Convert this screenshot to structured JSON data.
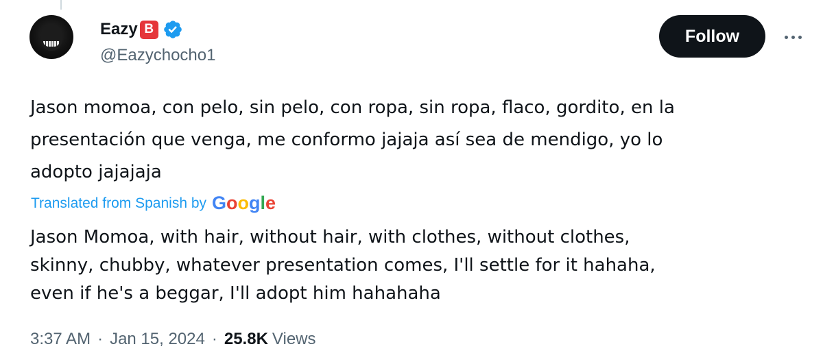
{
  "author": {
    "display_name": "Eazy",
    "badge_letter": "B",
    "handle": "@Eazychocho1"
  },
  "follow_label": "Follow",
  "tweet": {
    "text_lines": [
      "Jason momoa, con pelo, sin pelo, con ropa, sin ropa, flaco, gordito, en la",
      "presentación que venga, me conformo jajaja así sea de mendigo, yo lo",
      "adopto jajajaja"
    ],
    "translated_label": "Translated from Spanish by",
    "translation_provider": [
      "G",
      "o",
      "o",
      "g",
      "l",
      "e"
    ],
    "translation_lines": [
      "Jason Momoa, with hair, without hair, with clothes, without clothes,",
      "skinny, chubby, whatever presentation comes, I'll settle for it hahaha,",
      "even if he's a beggar, I'll adopt him hahahaha"
    ]
  },
  "meta": {
    "time": "3:37 AM",
    "separator": "·",
    "date": "Jan 15, 2024",
    "views_count": "25.8K",
    "views_label": "Views"
  },
  "colors": {
    "accent": "#1d9bf0",
    "badge_red": "#e5363a",
    "google_letters": [
      "#4285F4",
      "#EA4335",
      "#FBBC05",
      "#4285F4",
      "#34A853",
      "#EA4335"
    ]
  }
}
